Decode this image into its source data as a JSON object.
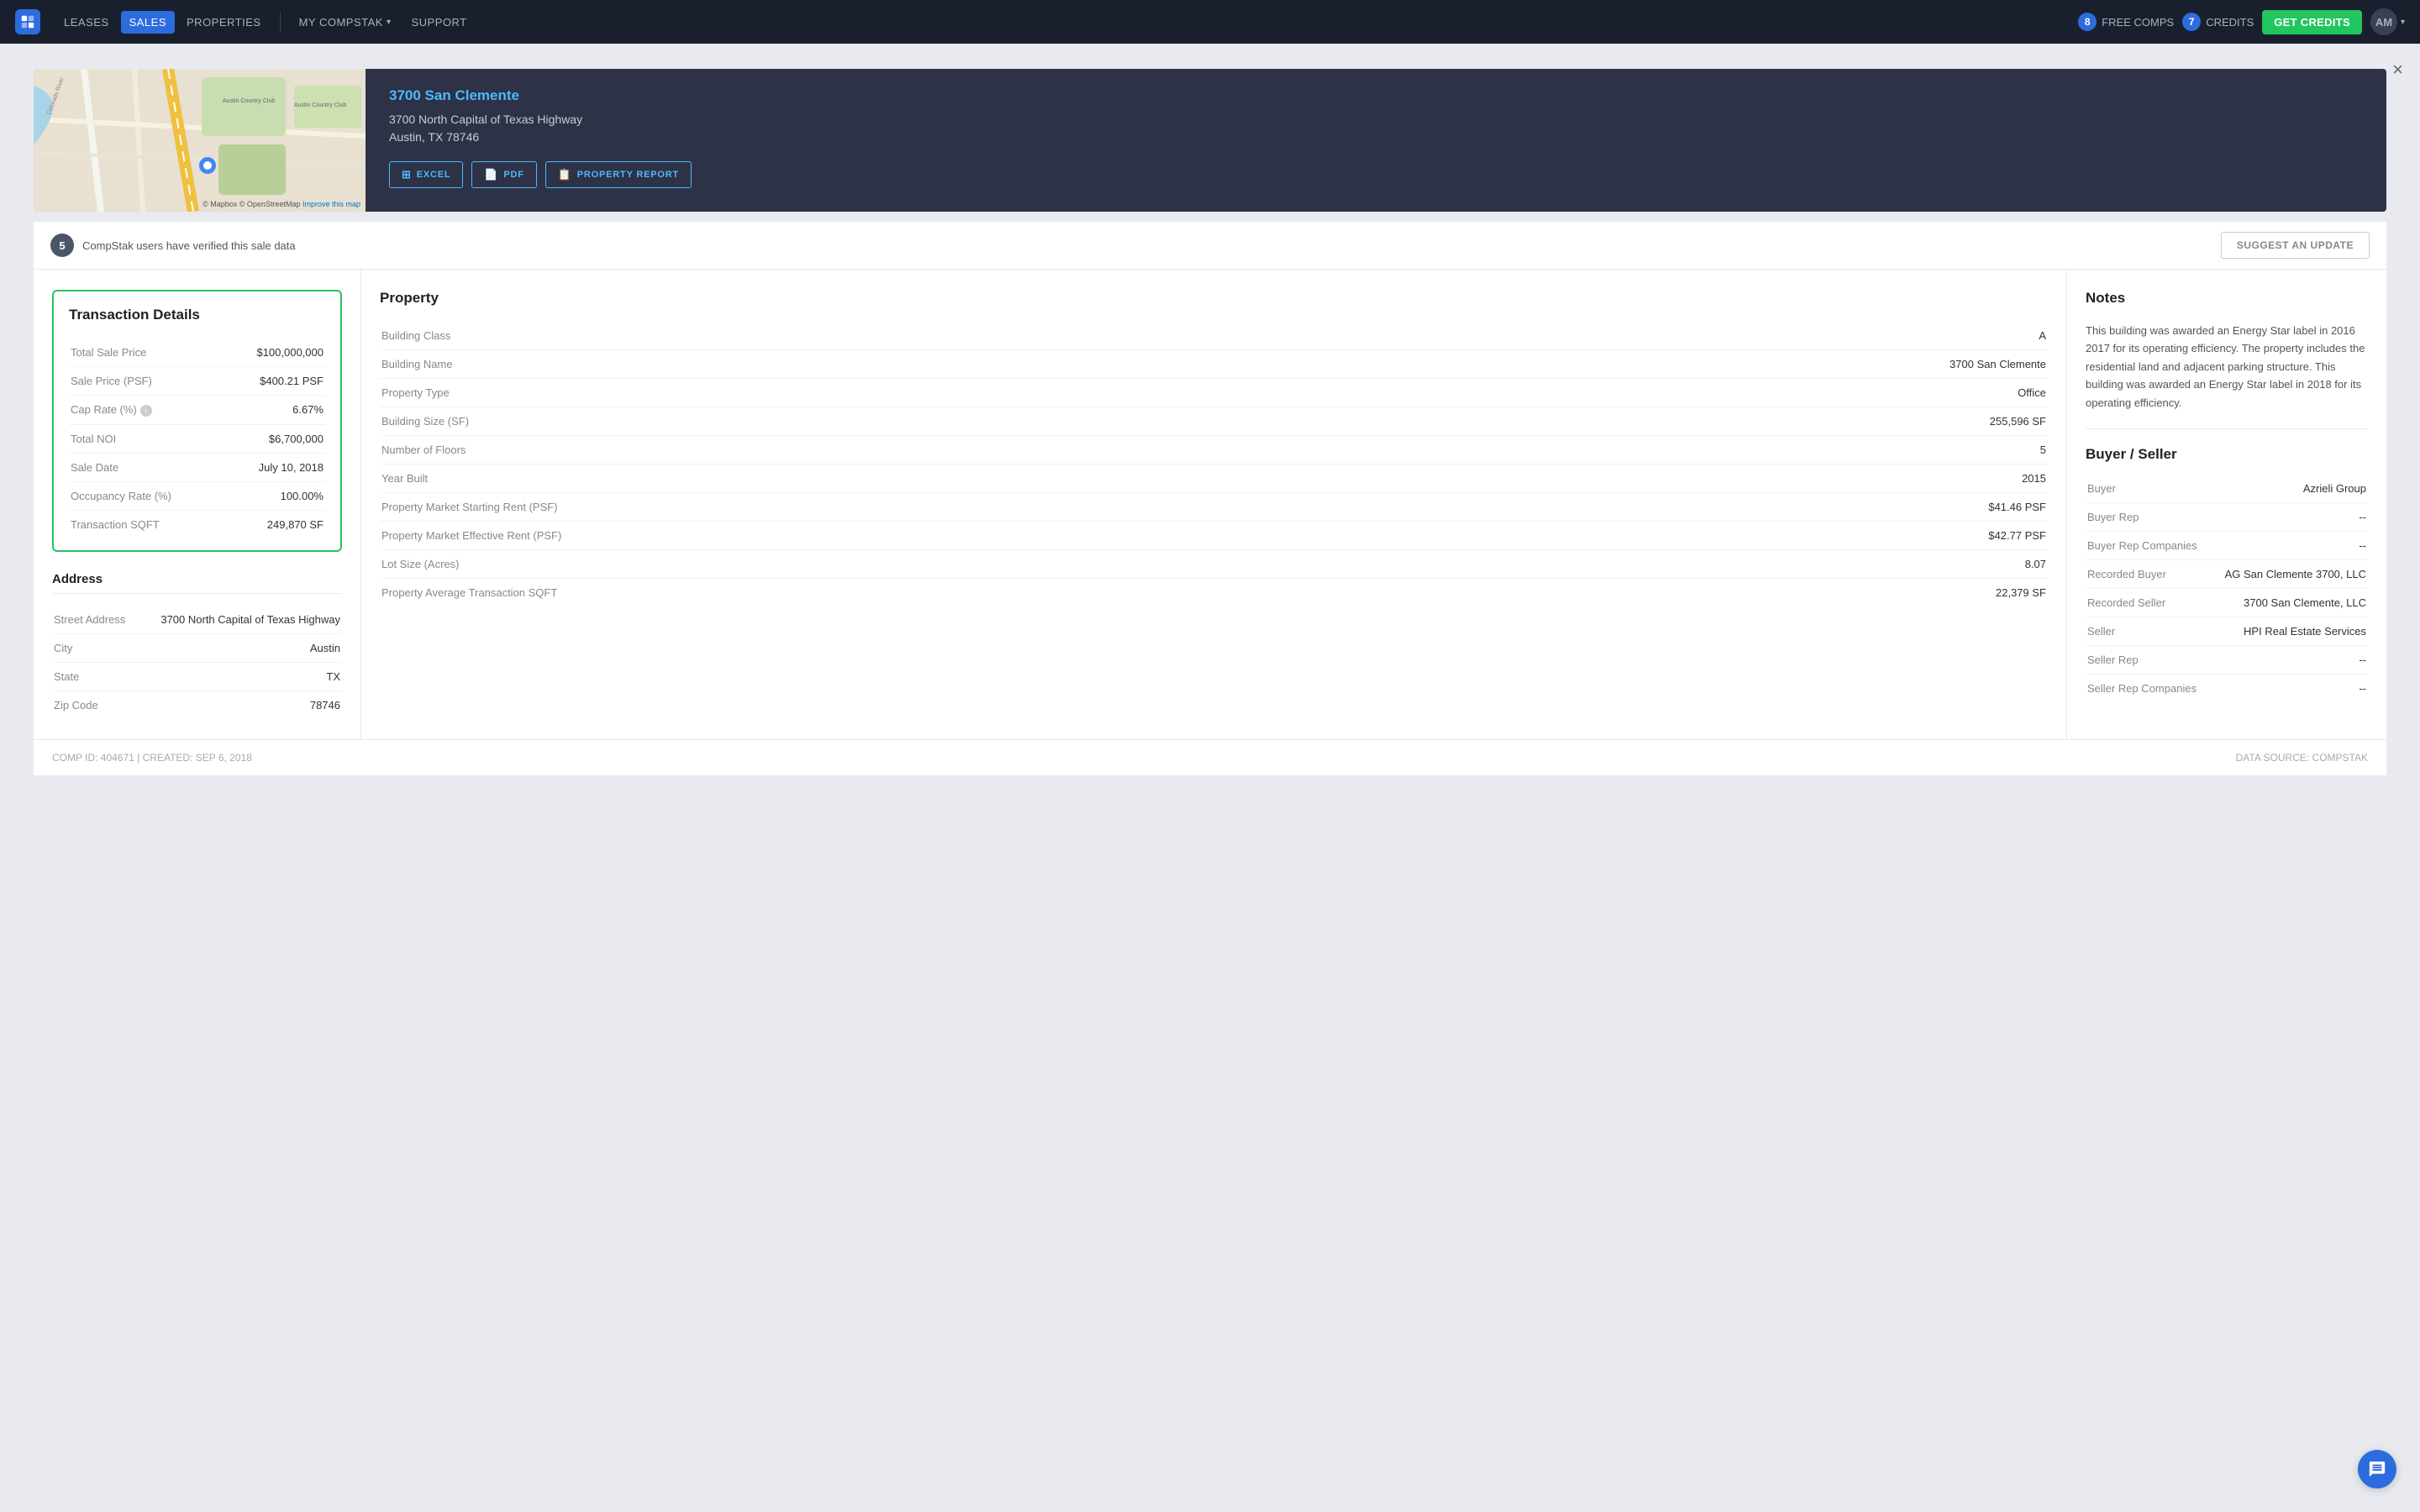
{
  "nav": {
    "logo_label": "CS",
    "links": [
      {
        "id": "leases",
        "label": "LEASES",
        "active": false
      },
      {
        "id": "sales",
        "label": "SALES",
        "active": true
      },
      {
        "id": "properties",
        "label": "PROPERTIES",
        "active": false
      }
    ],
    "dropdown_label": "MY COMPSTAK",
    "support_label": "SUPPORT",
    "free_comps_count": "8",
    "free_comps_label": "FREE COMPS",
    "credits_count": "7",
    "credits_label": "CREDITS",
    "get_credits_label": "GET CREDITS",
    "avatar_initials": "AM"
  },
  "close_label": "×",
  "property": {
    "name": "3700 San Clemente",
    "address_line1": "3700 North Capital of Texas Highway",
    "address_line2": "Austin, TX 78746",
    "actions": [
      {
        "id": "excel",
        "label": "EXCEL",
        "icon": "⊞"
      },
      {
        "id": "pdf",
        "label": "PDF",
        "icon": "📄"
      },
      {
        "id": "report",
        "label": "PROPERTY REPORT",
        "icon": "📋"
      }
    ]
  },
  "verified": {
    "count": "5",
    "text": "CompStak users have verified this sale data",
    "suggest_label": "SUGGEST AN UPDATE"
  },
  "transaction": {
    "title": "Transaction Details",
    "rows": [
      {
        "label": "Total Sale Price",
        "value": "$100,000,000"
      },
      {
        "label": "Sale Price (PSF)",
        "value": "$400.21 PSF"
      },
      {
        "label": "Cap Rate (%)",
        "value": "6.67%",
        "has_info": true
      },
      {
        "label": "Total NOI",
        "value": "$6,700,000"
      },
      {
        "label": "Sale Date",
        "value": "July 10, 2018"
      },
      {
        "label": "Occupancy Rate (%)",
        "value": "100.00%"
      },
      {
        "label": "Transaction SQFT",
        "value": "249,870 SF"
      }
    ]
  },
  "address": {
    "title": "Address",
    "rows": [
      {
        "label": "Street Address",
        "value": "3700 North Capital of Texas Highway"
      },
      {
        "label": "City",
        "value": "Austin"
      },
      {
        "label": "State",
        "value": "TX"
      },
      {
        "label": "Zip Code",
        "value": "78746"
      }
    ]
  },
  "property_section": {
    "title": "Property",
    "rows": [
      {
        "label": "Building Class",
        "value": "A"
      },
      {
        "label": "Building Name",
        "value": "3700 San Clemente"
      },
      {
        "label": "Property Type",
        "value": "Office"
      },
      {
        "label": "Building Size (SF)",
        "value": "255,596 SF"
      },
      {
        "label": "Number of Floors",
        "value": "5"
      },
      {
        "label": "Year Built",
        "value": "2015"
      },
      {
        "label": "Property Market Starting Rent (PSF)",
        "value": "$41.46 PSF"
      },
      {
        "label": "Property Market Effective Rent (PSF)",
        "value": "$42.77 PSF"
      },
      {
        "label": "Lot Size (Acres)",
        "value": "8.07"
      },
      {
        "label": "Property Average Transaction SQFT",
        "value": "22,379 SF"
      }
    ]
  },
  "notes": {
    "title": "Notes",
    "text": "This building was awarded an Energy Star label in 2016 2017 for its operating efficiency. The property includes the residential land and adjacent parking structure. This building was awarded an Energy Star label in 2018 for its operating efficiency."
  },
  "buyer_seller": {
    "title": "Buyer / Seller",
    "rows": [
      {
        "label": "Buyer",
        "value": "Azrieli Group"
      },
      {
        "label": "Buyer Rep",
        "value": "--"
      },
      {
        "label": "Buyer Rep Companies",
        "value": "--"
      },
      {
        "label": "Recorded Buyer",
        "value": "AG San Clemente 3700, LLC"
      },
      {
        "label": "Recorded Seller",
        "value": "3700 San Clemente, LLC"
      },
      {
        "label": "Seller",
        "value": "HPI Real Estate Services"
      },
      {
        "label": "Seller Rep",
        "value": "--"
      },
      {
        "label": "Seller Rep Companies",
        "value": "--"
      }
    ]
  },
  "footer": {
    "left": "COMP ID: 404671 | CREATED: SEP 6, 2018",
    "right": "DATA SOURCE: COMPSTAK"
  }
}
